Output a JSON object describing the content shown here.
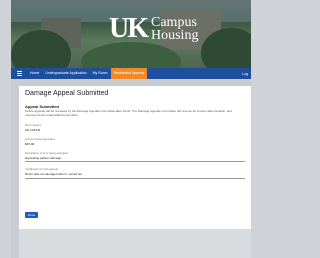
{
  "header": {
    "logo_mark": "UK",
    "logo_line1": "Campus",
    "logo_line2": "Housing"
  },
  "nav": {
    "items": [
      {
        "label": "Home",
        "active": false
      },
      {
        "label": "Undergraduate Application",
        "active": false
      },
      {
        "label": "My Room",
        "active": false
      },
      {
        "label": "Residential Appeals",
        "active": true
      }
    ],
    "right_label": "Log"
  },
  "page": {
    "title": "Damage Appeal Submitted",
    "subtitle": "Appeal Submitted",
    "description": "Online appeals will be reviewed by the Damage Appeals Committee after its list. The Damage Appeals Committee will reverse an invoice determination, and respond via the email address provided.",
    "fields": [
      {
        "label": "Room Space",
        "value": "KH-1234-B"
      },
      {
        "label": "Amount being appealed",
        "value": "$45.00"
      },
      {
        "label": "Description of item being appealed",
        "value": "Expanding pattern damage"
      },
      {
        "label": "Justification for this appeal",
        "value": "Room was not damaged when I moved out"
      }
    ],
    "button_label": "Done"
  },
  "colors": {
    "navbar": "#1e4f9e",
    "active_tab": "#f0892a",
    "button": "#1e5fb3"
  }
}
